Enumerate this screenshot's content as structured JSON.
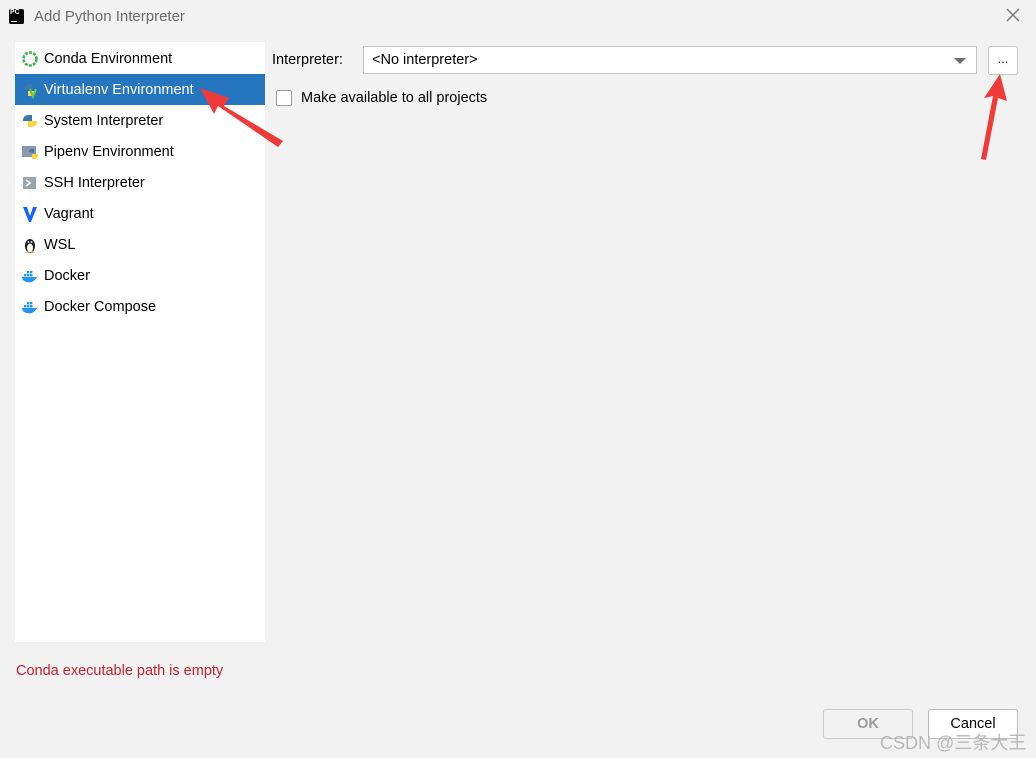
{
  "window": {
    "title": "Add Python Interpreter"
  },
  "sidebar": {
    "items": [
      {
        "label": "Conda Environment",
        "icon": "conda-icon"
      },
      {
        "label": "Virtualenv Environment",
        "icon": "virtualenv-icon",
        "selected": true
      },
      {
        "label": "System Interpreter",
        "icon": "python-icon"
      },
      {
        "label": "Pipenv Environment",
        "icon": "pipenv-icon"
      },
      {
        "label": "SSH Interpreter",
        "icon": "ssh-icon"
      },
      {
        "label": "Vagrant",
        "icon": "vagrant-icon"
      },
      {
        "label": "WSL",
        "icon": "linux-penguin-icon"
      },
      {
        "label": "Docker",
        "icon": "docker-icon"
      },
      {
        "label": "Docker Compose",
        "icon": "docker-compose-icon"
      }
    ]
  },
  "main": {
    "interpreter_label": "Interpreter:",
    "interpreter_value": "<No interpreter>",
    "browse_label": "...",
    "make_available_label": "Make available to all projects",
    "make_available_checked": false
  },
  "error_message": "Conda executable path is empty",
  "buttons": {
    "ok": "OK",
    "cancel": "Cancel"
  },
  "watermark": "CSDN @三条大王",
  "colors": {
    "selection": "#2675bf",
    "error": "#c7222d",
    "annotation_arrow": "#f03a3a"
  }
}
